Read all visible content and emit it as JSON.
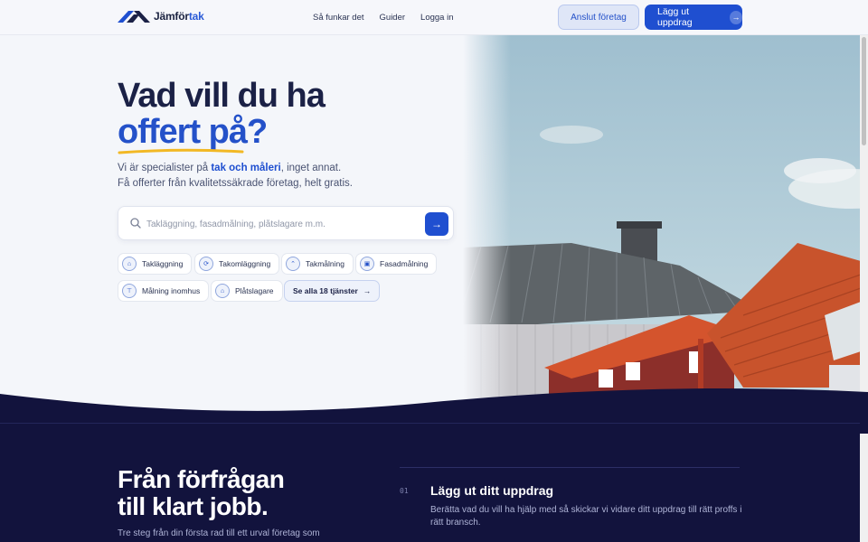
{
  "brand": {
    "name_part1": "Jämför",
    "name_part2": "tak",
    "accent_color": "#1f4fd0",
    "dark_color": "#12133d"
  },
  "nav": {
    "links": [
      "Så funkar det",
      "Guider",
      "Logga in"
    ],
    "secondary_button": "Anslut företag",
    "primary_button": "Lägg ut uppdrag",
    "primary_icon": "arrow-right-icon"
  },
  "hero": {
    "title_line1": "Vad vill du ha",
    "title_line2": "offert på?",
    "sub_prefix": "Vi är specialister på ",
    "sub_highlight": "tak och måleri",
    "sub_suffix": ", inget annat.",
    "sub_line2": "Få offerter från kvalitetssäkrade företag, helt gratis."
  },
  "search": {
    "placeholder": "Takläggning, fasadmålning, plåtslagare m.m.",
    "value": "",
    "icon": "search-icon",
    "button_icon": "arrow-right-icon"
  },
  "services": [
    {
      "label": "Takläggning",
      "icon": "house-roof-icon"
    },
    {
      "label": "Takomläggning",
      "icon": "refresh-roof-icon"
    },
    {
      "label": "Takmålning",
      "icon": "roof-paint-icon"
    },
    {
      "label": "Fasadmålning",
      "icon": "facade-paint-icon"
    },
    {
      "label": "Målning inomhus",
      "icon": "paint-roller-icon"
    },
    {
      "label": "Plåtslagare",
      "icon": "sheet-metal-icon"
    }
  ],
  "services_all": "Se alla 18 tjänster",
  "process": {
    "title_line1": "Från förfrågan",
    "title_line2": "till klart jobb.",
    "subtitle": "Tre steg från din första rad till ett urval företag som",
    "steps": [
      {
        "num": "01",
        "title": "Lägg ut ditt uppdrag",
        "desc": "Berätta vad du vill ha hjälp med så skickar vi vidare ditt uppdrag till rätt proffs i rätt bransch."
      }
    ]
  }
}
